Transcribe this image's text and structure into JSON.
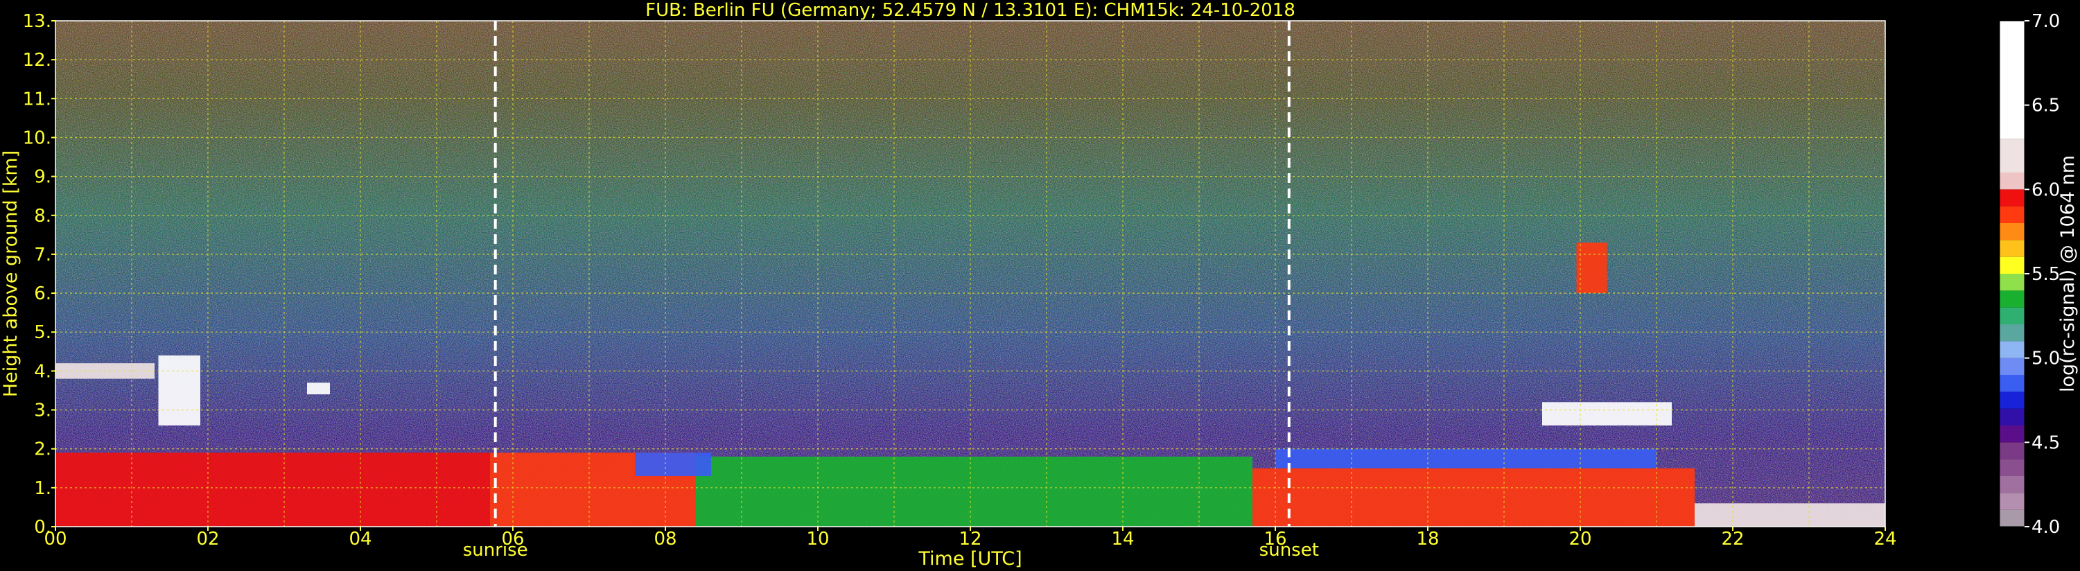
{
  "chart_data": {
    "type": "heatmap",
    "title": "FUB: Berlin FU (Germany; 52.4579 N / 13.3101 E):    CHM15k: 24-10-2018",
    "xlabel": "Time [UTC]",
    "ylabel": "Height above ground [km]",
    "xlim": [
      0,
      24
    ],
    "ylim": [
      0,
      13
    ],
    "x_ticks": [
      "00",
      "02",
      "04",
      "06",
      "08",
      "10",
      "12",
      "14",
      "16",
      "18",
      "20",
      "22",
      "24"
    ],
    "y_ticks": [
      "0.",
      "1.",
      "2.",
      "3.",
      "4.",
      "5.",
      "6.",
      "7.",
      "8.",
      "9.",
      "10.",
      "11.",
      "12.",
      "13."
    ],
    "grid": true,
    "colorbar": {
      "label": "log(rc-signal) @ 1064 nm",
      "range": [
        4.0,
        7.0
      ],
      "ticks": [
        "4.0",
        "4.5",
        "5.0",
        "5.5",
        "6.0",
        "6.5",
        "7.0"
      ],
      "bands": [
        {
          "from": 4.0,
          "to": 4.1,
          "color": "#a89aa8"
        },
        {
          "from": 4.1,
          "to": 4.2,
          "color": "#b48fb0"
        },
        {
          "from": 4.2,
          "to": 4.3,
          "color": "#a070a0"
        },
        {
          "from": 4.3,
          "to": 4.4,
          "color": "#8a4f8e"
        },
        {
          "from": 4.4,
          "to": 4.5,
          "color": "#7a3a86"
        },
        {
          "from": 4.5,
          "to": 4.6,
          "color": "#5a0e8a"
        },
        {
          "from": 4.6,
          "to": 4.7,
          "color": "#3010a8"
        },
        {
          "from": 4.7,
          "to": 4.8,
          "color": "#1822d8"
        },
        {
          "from": 4.8,
          "to": 4.9,
          "color": "#3a5df2"
        },
        {
          "from": 4.9,
          "to": 5.0,
          "color": "#6f8cf5"
        },
        {
          "from": 5.0,
          "to": 5.1,
          "color": "#8eb6f2"
        },
        {
          "from": 5.1,
          "to": 5.2,
          "color": "#5aa7a0"
        },
        {
          "from": 5.2,
          "to": 5.3,
          "color": "#2fb070"
        },
        {
          "from": 5.3,
          "to": 5.4,
          "color": "#19b030"
        },
        {
          "from": 5.4,
          "to": 5.5,
          "color": "#8fe04a"
        },
        {
          "from": 5.5,
          "to": 5.6,
          "color": "#ffff20"
        },
        {
          "from": 5.6,
          "to": 5.7,
          "color": "#ffc21a"
        },
        {
          "from": 5.7,
          "to": 5.8,
          "color": "#ff8a14"
        },
        {
          "from": 5.8,
          "to": 5.9,
          "color": "#ff3a10"
        },
        {
          "from": 5.9,
          "to": 6.0,
          "color": "#f01010"
        },
        {
          "from": 6.0,
          "to": 6.1,
          "color": "#eec4c4"
        },
        {
          "from": 6.1,
          "to": 6.3,
          "color": "#eee2e2"
        },
        {
          "from": 6.3,
          "to": 7.0,
          "color": "#ffffff"
        }
      ]
    },
    "markers": [
      {
        "label": "sunrise",
        "x": 5.77
      },
      {
        "label": "sunset",
        "x": 16.18
      }
    ],
    "layers": [
      {
        "name": "boundary-layer-night",
        "x": [
          0.0,
          5.7
        ],
        "y": [
          0.0,
          1.9
        ],
        "value": 6.0
      },
      {
        "name": "boundary-layer-morning",
        "x": [
          5.7,
          8.4
        ],
        "y": [
          0.0,
          1.9
        ],
        "value": 5.9
      },
      {
        "name": "boundary-layer-day",
        "x": [
          8.4,
          15.7
        ],
        "y": [
          0.0,
          1.8
        ],
        "value": 5.35
      },
      {
        "name": "boundary-layer-evening",
        "x": [
          15.7,
          21.5
        ],
        "y": [
          0.0,
          1.5
        ],
        "value": 5.9
      },
      {
        "name": "boundary-layer-late",
        "x": [
          21.5,
          24.0
        ],
        "y": [
          0.0,
          0.6
        ],
        "value": 6.3
      },
      {
        "name": "aerosol-top-morning",
        "x": [
          7.6,
          8.6
        ],
        "y": [
          1.3,
          1.9
        ],
        "value": 4.85
      },
      {
        "name": "elevated-layer-evening",
        "x": [
          16.0,
          21.0
        ],
        "y": [
          1.5,
          2.0
        ],
        "value": 4.9
      },
      {
        "name": "residual-layer-night",
        "x": [
          0.0,
          1.3
        ],
        "y": [
          3.8,
          4.2
        ],
        "value": 6.3
      },
      {
        "name": "cloud-0145",
        "x": [
          1.35,
          1.9
        ],
        "y": [
          2.6,
          4.4
        ],
        "value": 6.6
      },
      {
        "name": "cloud-0330",
        "x": [
          3.3,
          3.6
        ],
        "y": [
          3.4,
          3.7
        ],
        "value": 6.6
      },
      {
        "name": "cloud-2000",
        "x": [
          19.95,
          20.35
        ],
        "y": [
          6.0,
          7.3
        ],
        "value": 5.9
      },
      {
        "name": "cloud-2030",
        "x": [
          19.5,
          21.2
        ],
        "y": [
          2.6,
          3.2
        ],
        "value": 6.4
      }
    ]
  }
}
